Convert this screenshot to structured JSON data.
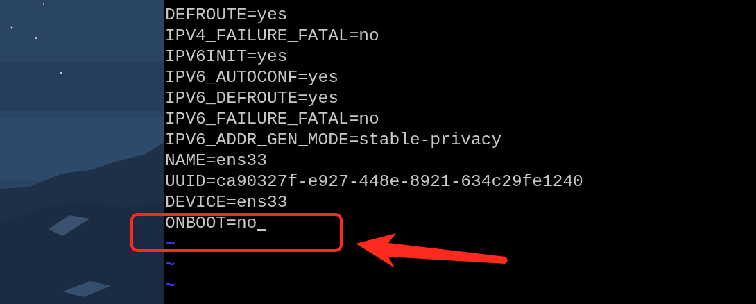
{
  "editor": {
    "lines": [
      {
        "kind": "text",
        "text": "DEFROUTE=yes",
        "cursor": false
      },
      {
        "kind": "text",
        "text": "IPV4_FAILURE_FATAL=no",
        "cursor": false
      },
      {
        "kind": "text",
        "text": "IPV6INIT=yes",
        "cursor": false
      },
      {
        "kind": "text",
        "text": "IPV6_AUTOCONF=yes",
        "cursor": false
      },
      {
        "kind": "text",
        "text": "IPV6_DEFROUTE=yes",
        "cursor": false
      },
      {
        "kind": "text",
        "text": "IPV6_FAILURE_FATAL=no",
        "cursor": false
      },
      {
        "kind": "text",
        "text": "IPV6_ADDR_GEN_MODE=stable-privacy",
        "cursor": false
      },
      {
        "kind": "text",
        "text": "NAME=ens33",
        "cursor": false
      },
      {
        "kind": "text",
        "text": "UUID=ca90327f-e927-448e-8921-634c29fe1240",
        "cursor": false
      },
      {
        "kind": "text",
        "text": "DEVICE=ens33",
        "cursor": false
      },
      {
        "kind": "text",
        "text": "ONBOOT=no",
        "cursor": true
      },
      {
        "kind": "empty",
        "text": "~"
      },
      {
        "kind": "empty",
        "text": "~"
      },
      {
        "kind": "empty",
        "text": "~"
      }
    ]
  }
}
